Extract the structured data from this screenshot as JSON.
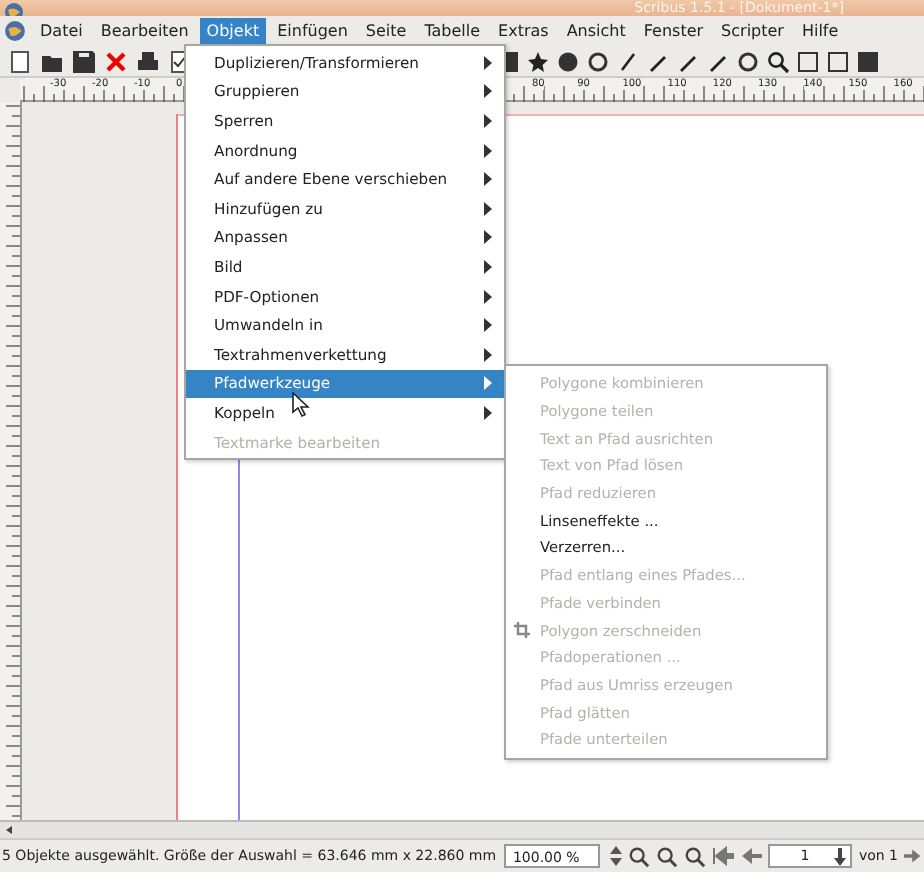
{
  "window": {
    "title": "Scribus 1.5.1 - [Dokument-1*]"
  },
  "menubar": [
    {
      "label": "Datei",
      "selected": false
    },
    {
      "label": "Bearbeiten",
      "selected": false
    },
    {
      "label": "Objekt",
      "selected": true
    },
    {
      "label": "Einfügen",
      "selected": false
    },
    {
      "label": "Seite",
      "selected": false
    },
    {
      "label": "Tabelle",
      "selected": false
    },
    {
      "label": "Extras",
      "selected": false
    },
    {
      "label": "Ansicht",
      "selected": false
    },
    {
      "label": "Fenster",
      "selected": false
    },
    {
      "label": "Scripter",
      "selected": false
    },
    {
      "label": "Hilfe",
      "selected": false
    }
  ],
  "ruler": {
    "labels": [
      "-30",
      "-20",
      "-10",
      "0",
      "80",
      "90",
      "100",
      "110",
      "120",
      "130",
      "140",
      "150",
      "160"
    ]
  },
  "object_menu": [
    {
      "label": "Duplizieren/Transformieren",
      "submenu": true,
      "disabled": false,
      "selected": false
    },
    {
      "label": "Gruppieren",
      "submenu": true,
      "disabled": false,
      "selected": false
    },
    {
      "label": "Sperren",
      "submenu": true,
      "disabled": false,
      "selected": false
    },
    {
      "label": "Anordnung",
      "submenu": true,
      "disabled": false,
      "selected": false
    },
    {
      "label": "Auf andere Ebene verschieben",
      "submenu": true,
      "disabled": false,
      "selected": false
    },
    {
      "label": "Hinzufügen zu",
      "submenu": true,
      "disabled": false,
      "selected": false
    },
    {
      "label": "Anpassen",
      "submenu": true,
      "disabled": false,
      "selected": false
    },
    {
      "label": "Bild",
      "submenu": true,
      "disabled": false,
      "selected": false
    },
    {
      "label": "PDF-Optionen",
      "submenu": true,
      "disabled": false,
      "selected": false
    },
    {
      "label": "Umwandeln in",
      "submenu": true,
      "disabled": false,
      "selected": false
    },
    {
      "label": "Textrahmenverkettung",
      "submenu": true,
      "disabled": false,
      "selected": false
    },
    {
      "label": "Pfadwerkzeuge",
      "submenu": true,
      "disabled": false,
      "selected": true
    },
    {
      "label": "Koppeln",
      "submenu": true,
      "disabled": false,
      "selected": false
    },
    {
      "label": "Textmarke bearbeiten",
      "submenu": false,
      "disabled": true,
      "selected": false
    }
  ],
  "path_tools_menu": [
    {
      "label": "Polygone kombinieren",
      "disabled": true,
      "icon": false
    },
    {
      "label": "Polygone teilen",
      "disabled": true,
      "icon": false
    },
    {
      "label": "Text an Pfad ausrichten",
      "disabled": true,
      "icon": false
    },
    {
      "label": "Text von Pfad lösen",
      "disabled": true,
      "icon": false
    },
    {
      "label": "Pfad reduzieren",
      "disabled": true,
      "icon": false
    },
    {
      "label": "Linseneffekte ...",
      "disabled": false,
      "icon": false
    },
    {
      "label": "Verzerren...",
      "disabled": false,
      "icon": false
    },
    {
      "label": "Pfad entlang eines Pfades...",
      "disabled": true,
      "icon": false
    },
    {
      "label": "Pfade verbinden",
      "disabled": true,
      "icon": false
    },
    {
      "label": "Polygon zerschneiden",
      "disabled": true,
      "icon": true
    },
    {
      "label": "Pfadoperationen ...",
      "disabled": true,
      "icon": false
    },
    {
      "label": "Pfad aus Umriss erzeugen",
      "disabled": true,
      "icon": false
    },
    {
      "label": "Pfad glätten",
      "disabled": true,
      "icon": false
    },
    {
      "label": "Pfade unterteilen",
      "disabled": true,
      "icon": false
    }
  ],
  "status_bar": {
    "message": "5 Objekte ausgewählt. Größe der Auswahl = 63.646 mm x 22.860 mm",
    "zoom": "100.00 %",
    "page": "1",
    "page_count": "von 1"
  }
}
